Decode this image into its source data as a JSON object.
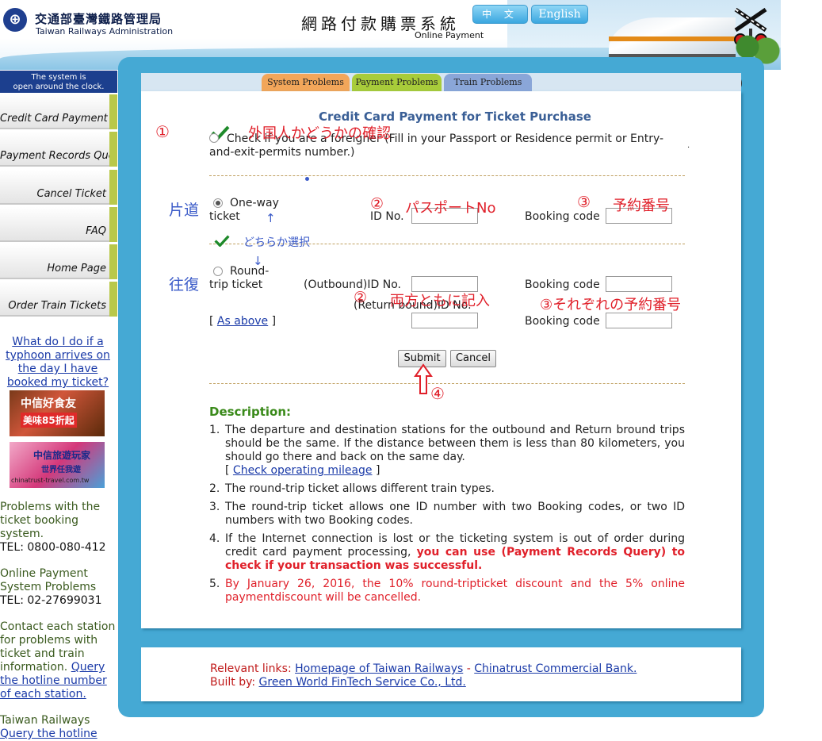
{
  "header": {
    "org_cn": "交通部臺灣鐵路管理局",
    "org_en": "Taiwan Railways Administration",
    "title_cn": "網路付款購票系統",
    "title_en": "Online Payment",
    "lang_zh": "中 文",
    "lang_en": "English"
  },
  "sidebar": {
    "notice_line1": "The system is",
    "notice_line2": "open around the clock.",
    "items": [
      {
        "label": "Credit Card Payment"
      },
      {
        "label": "Payment Records Query"
      },
      {
        "label": "Cancel Ticket"
      },
      {
        "label": "FAQ"
      },
      {
        "label": "Home Page"
      },
      {
        "label": "Order Train Tickets"
      }
    ],
    "typhoon_link": "What do I do if a typhoon arrives on the day I have booked my ticket?",
    "banner1_title": "中信好食友",
    "banner1_sub": "美味85折起",
    "banner2_title": "中信旅遊玩家",
    "banner2_sub": "世界任我遊",
    "banner2_url": "chinatrust-travel.com.tw",
    "problems_text": "Problems with the ticket booking system.",
    "problems_tel": "TEL: 0800-080-412",
    "online_text": "Online Payment System Problems",
    "online_tel": "TEL: 02-27699031",
    "contact_text": "Contact each station for problems with ticket and train information.",
    "contact_link": "Query the hotline number of each station.",
    "tr_text": "Taiwan Railways",
    "tr_link": "Query the hotline"
  },
  "tabs": {
    "system": "System Problems",
    "payment": "Payment Problems",
    "train": "Train Problems"
  },
  "form": {
    "title": "Credit Card Payment for Ticket Purchase",
    "foreigner_label": "Check if you are a foreigner (Fill in your Passport or Residence permit or Entry-and-exit-permits number.)",
    "oneway_label_1": "One-way",
    "oneway_label_2": "ticket",
    "id_label": "ID No.",
    "booking_label": "Booking code",
    "round_label_1": "Round-",
    "round_label_2": "trip ticket",
    "outbound_label": "(Outbound)ID No.",
    "return_label": "(Return bound)ID No.",
    "as_above_open": "[",
    "as_above_link": "As above",
    "as_above_close": "]",
    "submit": "Submit",
    "cancel": "Cancel"
  },
  "annotations": {
    "n1": "①",
    "foreigner_note": "外国人かどうかの確認",
    "oneway": "片道",
    "n2a": "②",
    "passport": "パスポートNo",
    "n3a": "③",
    "reservation": "予約番号",
    "arrow_up": "↑",
    "either": "どちらか選択",
    "arrow_down": "↓",
    "roundtrip": "往復",
    "n2b": "②",
    "both": "両方ともに記入",
    "each": "③それぞれの予約番号",
    "n4": "④"
  },
  "description": {
    "heading": "Description:",
    "items": [
      {
        "n": "1.",
        "text": "The departure and destination stations for the outbound and Return bround trips should be the same. If the distance between them is less than 80 kilometers, you should go there and back on the same day.",
        "link_open": "[",
        "link": "Check operating mileage",
        "link_close": "]"
      },
      {
        "n": "2.",
        "text": "The round-trip ticket allows different train types."
      },
      {
        "n": "3.",
        "text": "The round-trip ticket allows one ID number with two Booking codes, or two ID numbers with two Booking codes."
      },
      {
        "n": "4.",
        "text": "If the Internet connection is lost or the ticketing system is out of order during credit card payment processing,",
        "red": "you can use (Payment Records Query) to check if your transaction was successful."
      },
      {
        "n": "5.",
        "text": "By January 26, 2016, the 10% round-tripticket discount and the 5% online paymentdiscount will be cancelled."
      }
    ]
  },
  "footer": {
    "relevant": "Relevant links:",
    "link1": "Homepage of Taiwan Railways",
    "sep": "-",
    "link2": "Chinatrust Commercial Bank.",
    "built": "Built by:",
    "link3": "Green World FinTech Service Co., Ltd."
  },
  "colors": {
    "frame": "#45a9d4",
    "nav_accent": "#b9c84a",
    "tab_system": "#f2a65a",
    "tab_payment": "#a8cc3a",
    "tab_train": "#8aa6d8",
    "annotation_red": "#e0202a",
    "annotation_blue": "#3b5bc8"
  }
}
